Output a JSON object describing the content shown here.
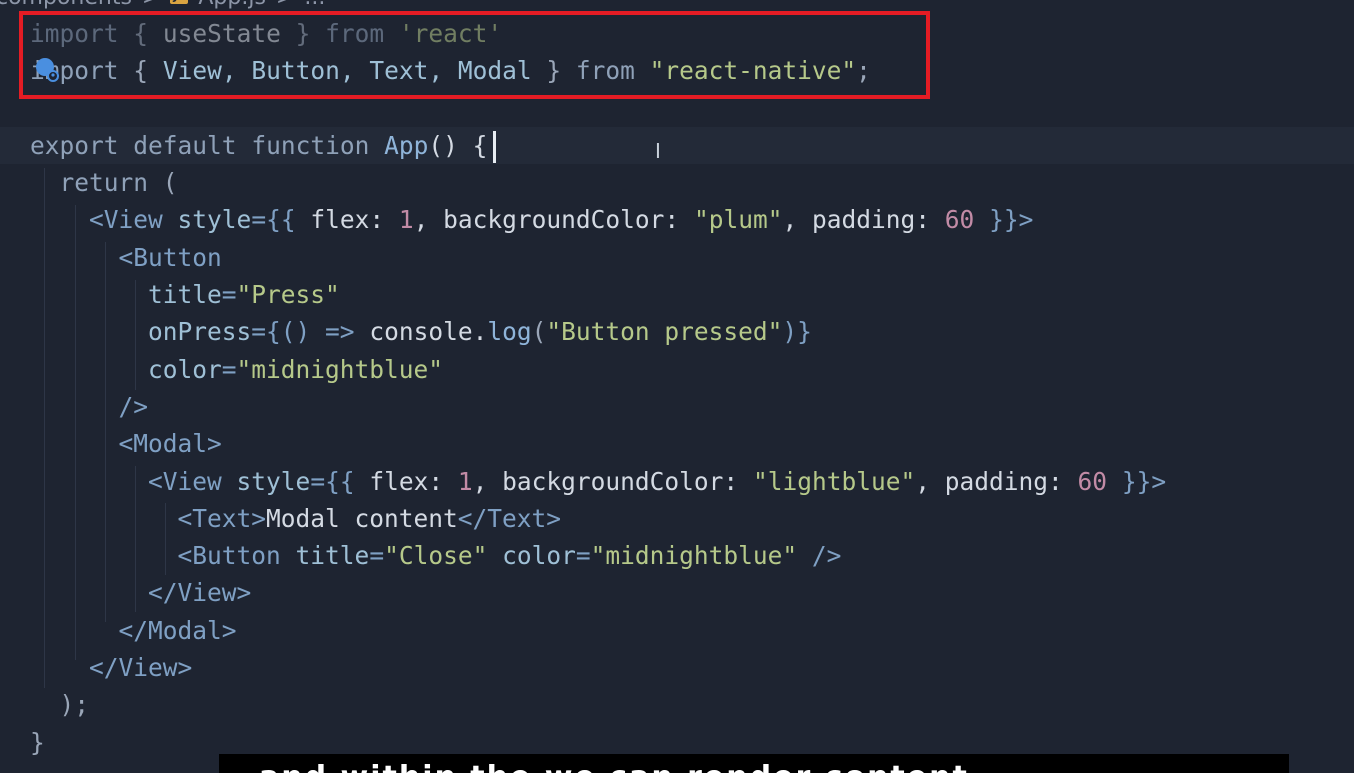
{
  "breadcrumb": {
    "folder": "components",
    "separator": ">",
    "file_badge": "JS",
    "file": "App.js",
    "tail": "..."
  },
  "code": {
    "line1": {
      "kw1": "import",
      "p1": "{",
      "id": "useState",
      "p2": "}",
      "kw2": "from",
      "str": "'react'"
    },
    "line2": {
      "kw1": "import",
      "p1": "{",
      "ids": "View, Button, Text, Modal",
      "p2": "}",
      "kw2": "from",
      "str": "\"react-native\"",
      "semi": ";"
    },
    "line4": {
      "kw1": "export",
      "kw2": "default",
      "kw3": "function",
      "fn": "App",
      "tail": "() {"
    },
    "line5": {
      "kw": "return",
      "p": "("
    },
    "line6": {
      "open": "<View",
      "attr": "style",
      "eq": "={{",
      "k1": "flex:",
      "v1": "1",
      "c1": ",",
      "k2": "backgroundColor:",
      "v2": "\"plum\"",
      "c2": ",",
      "k3": "padding:",
      "v3": "60",
      "close": "}}>"
    },
    "line7": {
      "tag": "<Button"
    },
    "line8": {
      "attr": "title",
      "eq": "=",
      "val": "\"Press\""
    },
    "line9": {
      "attr": "onPress",
      "eq": "={",
      "arrow": "() =>",
      "obj": "console",
      "dot": ".",
      "fn": "log",
      "lp": "(",
      "val": "\"Button pressed\"",
      "rp": ")}"
    },
    "line10": {
      "attr": "color",
      "eq": "=",
      "val": "\"midnightblue\""
    },
    "line11": {
      "tag": "/>"
    },
    "line12": {
      "tag": "<Modal>"
    },
    "line13": {
      "open": "<View",
      "attr": "style",
      "eq": "={{",
      "k1": "flex:",
      "v1": "1",
      "c1": ",",
      "k2": "backgroundColor:",
      "v2": "\"lightblue\"",
      "c2": ",",
      "k3": "padding:",
      "v3": "60",
      "close": "}}>"
    },
    "line14": {
      "open": "<Text>",
      "text": "Modal content",
      "close": "</Text>"
    },
    "line15": {
      "open": "<Button",
      "a1": "title",
      "eq1": "=",
      "v1": "\"Close\"",
      "a2": "color",
      "eq2": "=",
      "v2": "\"midnightblue\"",
      "close": "/>"
    },
    "line16": {
      "tag": "</View>"
    },
    "line17": {
      "tag": "</Modal>"
    },
    "line18": {
      "tag": "</View>"
    },
    "line19": {
      "text": ");"
    },
    "line20": {
      "text": "}"
    }
  },
  "colors": {
    "highlight_box": "#e41c24",
    "background": "#1e2431"
  },
  "subtitle": {
    "text": "and within the    we can render content"
  }
}
